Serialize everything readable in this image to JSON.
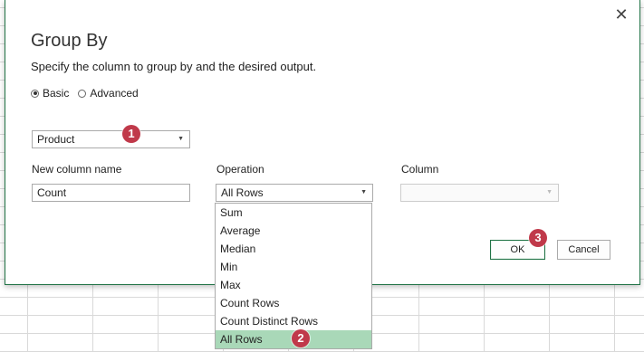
{
  "dialog": {
    "title": "Group By",
    "subtitle": "Specify the column to group by and the desired output.",
    "close_glyph": "✕",
    "radio": {
      "basic_label": "Basic",
      "advanced_label": "Advanced",
      "selected": "Basic"
    },
    "group_column": {
      "value": "Product"
    },
    "new_column": {
      "label": "New column name",
      "value": "Count"
    },
    "operation": {
      "label": "Operation",
      "value": "All Rows",
      "options": [
        "Sum",
        "Average",
        "Median",
        "Min",
        "Max",
        "Count Rows",
        "Count Distinct Rows",
        "All Rows"
      ]
    },
    "column": {
      "label": "Column",
      "value": ""
    },
    "ok_label": "OK",
    "cancel_label": "Cancel"
  },
  "markers": {
    "m1": "1",
    "m2": "2",
    "m3": "3"
  },
  "colors": {
    "accent": "#217346",
    "selected_item": "#a9d8b8",
    "marker": "#c0394a"
  },
  "icons": {
    "dropdown_arrow": "chevron-down-icon",
    "close": "close-icon"
  }
}
